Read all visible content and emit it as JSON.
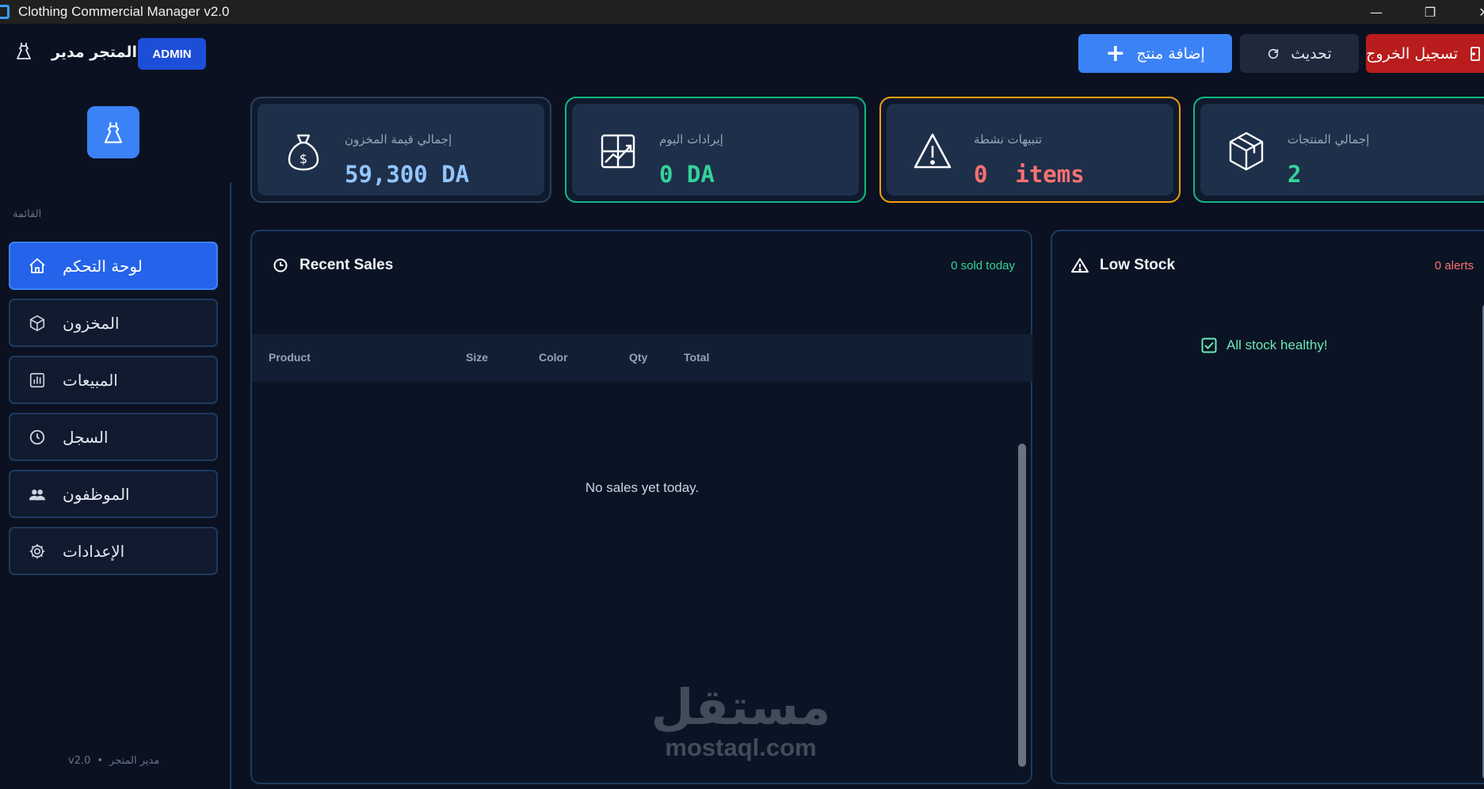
{
  "window": {
    "title": "Clothing Commercial Manager v2.0",
    "minimize": "—",
    "maximize": "❐",
    "close": "✕"
  },
  "header": {
    "store_name": "المتجر مدير",
    "role_badge": "ADMIN",
    "add_product_label": "إضافة منتج",
    "add_product_icon": "plus-icon",
    "refresh_label": "تحديث",
    "refresh_icon": "refresh-icon",
    "logout_label": "تسجيل الخروج",
    "logout_icon": "logout-icon",
    "accent_color": "#3b82f6",
    "danger_color": "#b91c1c"
  },
  "sidebar": {
    "menu_label": "القائمة",
    "items": [
      {
        "label": "لوحة التحكم",
        "icon": "home-icon",
        "active": true
      },
      {
        "label": "المخزون",
        "icon": "box-icon",
        "active": false
      },
      {
        "label": "المبيعات",
        "icon": "bar-chart-icon",
        "active": false
      },
      {
        "label": "السجل",
        "icon": "clock-icon",
        "active": false
      },
      {
        "label": "الموظفون",
        "icon": "users-icon",
        "active": false
      },
      {
        "label": "الإعدادات",
        "icon": "gear-icon",
        "active": false
      }
    ],
    "footer_version": "v2.0",
    "footer_separator": "•",
    "footer_role": "مدير المتجر"
  },
  "stats": [
    {
      "label": "إجمالي قيمة المخزون",
      "value": "59,300 DA",
      "icon": "money-bag-icon",
      "color": "#93c5fd"
    },
    {
      "label": "إيرادات اليوم",
      "value": "0 DA",
      "icon": "chart-growth-icon",
      "color": "#34d399"
    },
    {
      "label": "تنبيهات نشطة",
      "value": "0  items",
      "icon": "warning-icon",
      "color": "#f87171"
    },
    {
      "label": "إجمالي المنتجات",
      "value": "2",
      "icon": "package-icon",
      "color": "#34d399"
    }
  ],
  "recent_sales": {
    "title": "Recent Sales",
    "meta": "0 sold today",
    "columns": [
      "Product",
      "Size",
      "Color",
      "Qty",
      "Total"
    ],
    "empty_message": "No sales yet today."
  },
  "low_stock": {
    "title": "Low Stock",
    "meta": "0 alerts",
    "status_message": "All stock healthy!"
  },
  "watermark": {
    "arabic": "مستقل",
    "latin": "mostaql.com"
  }
}
